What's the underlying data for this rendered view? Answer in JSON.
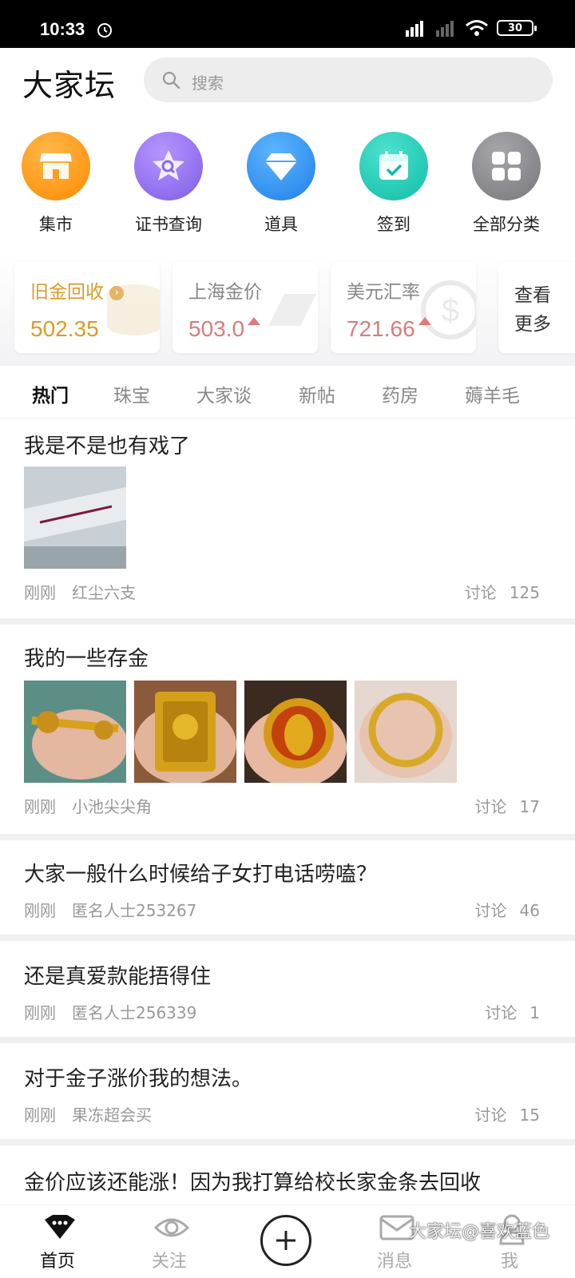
{
  "status": {
    "time": "10:33",
    "battery": "30"
  },
  "header": {
    "logo": "大家坛",
    "search_placeholder": "搜索"
  },
  "quick_links": [
    {
      "label": "集市",
      "icon": "market-icon",
      "color": "#ff9c1a"
    },
    {
      "label": "证书查询",
      "icon": "certificate-search-icon",
      "color": "#9a77ee"
    },
    {
      "label": "道具",
      "icon": "diamond-icon",
      "color": "#2f8ff0"
    },
    {
      "label": "签到",
      "icon": "calendar-check-icon",
      "color": "#1ccbb5"
    },
    {
      "label": "全部分类",
      "icon": "grid-icon",
      "color": "#8e8e93"
    }
  ],
  "prices": [
    {
      "title": "旧金回收",
      "value": "502.35",
      "color": "#e09a2a",
      "arrow": false
    },
    {
      "title": "上海金价",
      "value": "503.0",
      "color": "#d97c7c",
      "arrow": true
    },
    {
      "title": "美元汇率",
      "value": "721.66",
      "color": "#d97c7c",
      "arrow": true
    }
  ],
  "more": {
    "line1": "查看",
    "line2": "更多"
  },
  "tabs": [
    "热门",
    "珠宝",
    "大家谈",
    "新帖",
    "药房",
    "薅羊毛"
  ],
  "posts": [
    {
      "title": "我是不是也有戏了",
      "time": "刚刚",
      "author": "红尘六支",
      "stat_label": "讨论",
      "count": "125"
    },
    {
      "title": "我的一些存金",
      "time": "刚刚",
      "author": "小池尖尖角",
      "stat_label": "讨论",
      "count": "17"
    },
    {
      "title": "大家一般什么时候给子女打电话唠嗑？",
      "time": "刚刚",
      "author": "匿名人士253267",
      "stat_label": "讨论",
      "count": "46"
    },
    {
      "title": "还是真爱款能捂得住",
      "time": "刚刚",
      "author": "匿名人士256339",
      "stat_label": "讨论",
      "count": "1"
    },
    {
      "title": "对于金子涨价我的想法。",
      "time": "刚刚",
      "author": "果冻超会买",
      "stat_label": "讨论",
      "count": "15"
    },
    {
      "title": "金价应该还能涨！因为我打算给校长家金条去回收"
    }
  ],
  "nav": [
    {
      "label": "首页",
      "icon": "home-icon"
    },
    {
      "label": "关注",
      "icon": "eye-icon"
    },
    {
      "label": "",
      "icon": "plus-icon"
    },
    {
      "label": "消息",
      "icon": "mail-icon"
    },
    {
      "label": "我",
      "icon": "user-icon"
    }
  ],
  "watermark": "大家坛@喜欢蓝色"
}
